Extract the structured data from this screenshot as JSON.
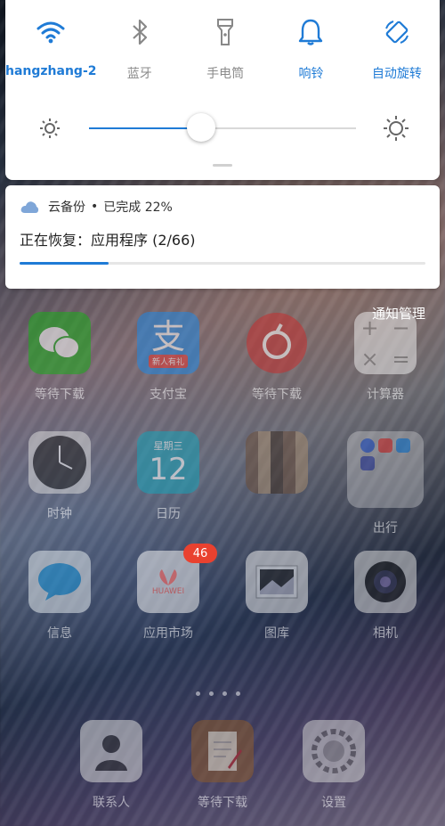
{
  "quick_settings": {
    "tiles": [
      {
        "label": "hangzhang-2",
        "icon": "wifi-icon",
        "active": true
      },
      {
        "label": "蓝牙",
        "icon": "bluetooth-icon",
        "active": false
      },
      {
        "label": "手电筒",
        "icon": "flashlight-icon",
        "active": false
      },
      {
        "label": "响铃",
        "icon": "bell-icon",
        "active": true
      },
      {
        "label": "自动旋转",
        "icon": "auto-rotate-icon",
        "active": true
      }
    ],
    "brightness_level": 0.42
  },
  "notification": {
    "app": "云备份",
    "separator": "•",
    "status": "已完成 22%",
    "message": "正在恢复：应用程序 (2/66)",
    "progress": 0.22
  },
  "notification_manage_label": "通知管理",
  "home_apps": [
    {
      "label": "等待下载",
      "icon": "wechat-icon"
    },
    {
      "label": "支付宝",
      "icon": "alipay-icon",
      "sub": "新人有礼"
    },
    {
      "label": "等待下载",
      "icon": "netease-music-icon"
    },
    {
      "label": "计算器",
      "icon": "calculator-icon"
    },
    {
      "label": "时钟",
      "icon": "clock-icon"
    },
    {
      "label": "日历",
      "icon": "calendar-icon",
      "weekday": "星期三",
      "day": "12"
    },
    {
      "label": "",
      "icon": "blurred-app-icon"
    },
    {
      "label": "出行",
      "icon": "folder-icon"
    },
    {
      "label": "信息",
      "icon": "messages-icon"
    },
    {
      "label": "应用市场",
      "icon": "appgallery-icon",
      "sub": "HUAWEI",
      "badge": "46"
    },
    {
      "label": "图库",
      "icon": "gallery-icon"
    },
    {
      "label": "相机",
      "icon": "camera-icon"
    }
  ],
  "dock_apps": [
    {
      "label": "联系人",
      "icon": "contacts-icon"
    },
    {
      "label": "等待下载",
      "icon": "notes-icon"
    },
    {
      "label": "设置",
      "icon": "settings-icon"
    }
  ],
  "colors": {
    "accent": "#1f7bd6",
    "badge": "#e9412f"
  }
}
